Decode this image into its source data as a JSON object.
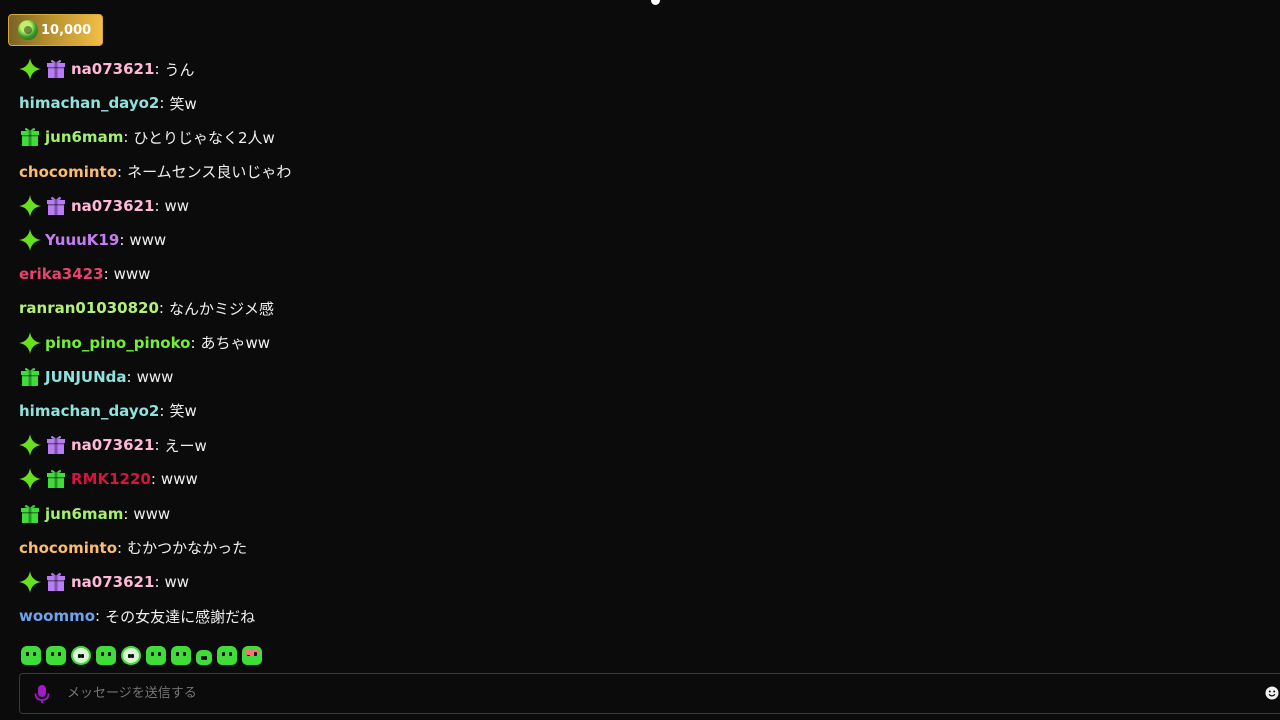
{
  "points": {
    "value": "10,000",
    "icon": "channel-points-icon"
  },
  "colors": {
    "sparkle": "#67e01e",
    "gift_purple": "#b97cf5",
    "gift_green": "#3fdc3a",
    "mic": "#a11ac6"
  },
  "messages": [
    {
      "badges": [
        "sparkle",
        "gift-purple"
      ],
      "user": "na073621",
      "color": "#ffb8d6",
      "text": "うん"
    },
    {
      "badges": [],
      "user": "himachan_dayo2",
      "color": "#90e2dc",
      "text": "笑w"
    },
    {
      "badges": [
        "gift-green"
      ],
      "user": "jun6mam",
      "color": "#a5f06a",
      "text": "ひとりじゃなく2人w"
    },
    {
      "badges": [],
      "user": "chocominto",
      "color": "#fbbc6f",
      "text": "ネームセンス良いじゃわ"
    },
    {
      "badges": [
        "sparkle",
        "gift-purple"
      ],
      "user": "na073621",
      "color": "#ffb8d6",
      "text": "ww"
    },
    {
      "badges": [
        "sparkle"
      ],
      "user": "YuuuK19",
      "color": "#c57cf5",
      "text": "www"
    },
    {
      "badges": [],
      "user": "erika3423",
      "color": "#e8436e",
      "text": "www"
    },
    {
      "badges": [],
      "user": "ranran01030820",
      "color": "#b5f07a",
      "text": "なんかミジメ感"
    },
    {
      "badges": [
        "sparkle"
      ],
      "user": "pino_pino_pinoko",
      "color": "#71f036",
      "text": "あちゃww"
    },
    {
      "badges": [
        "gift-green"
      ],
      "user": "JUNJUNda",
      "color": "#90e2dc",
      "text": "www"
    },
    {
      "badges": [],
      "user": "himachan_dayo2",
      "color": "#90e2dc",
      "text": "笑w"
    },
    {
      "badges": [
        "sparkle",
        "gift-purple"
      ],
      "user": "na073621",
      "color": "#ffb8d6",
      "text": "えーw"
    },
    {
      "badges": [
        "sparkle",
        "gift-green"
      ],
      "user": "RMK1220",
      "color": "#d5153c",
      "text": "www"
    },
    {
      "badges": [
        "gift-green"
      ],
      "user": "jun6mam",
      "color": "#a5f06a",
      "text": "www"
    },
    {
      "badges": [],
      "user": "chocominto",
      "color": "#fbbc6f",
      "text": "むかつかなかった"
    },
    {
      "badges": [
        "sparkle",
        "gift-purple"
      ],
      "user": "na073621",
      "color": "#ffb8d6",
      "text": "ww"
    },
    {
      "badges": [],
      "user": "woommo",
      "color": "#6fa3ee",
      "text": "その女友達に感謝だね"
    }
  ],
  "emotes": [
    "blob-emote",
    "angry-emote",
    "skull-emote",
    "blob-emote",
    "ghost-emote",
    "blob-emote",
    "blob-emote",
    "small-blob-emote",
    "blob-emote",
    "pink-blob-emote"
  ],
  "input": {
    "placeholder": "メッセージを送信する"
  }
}
